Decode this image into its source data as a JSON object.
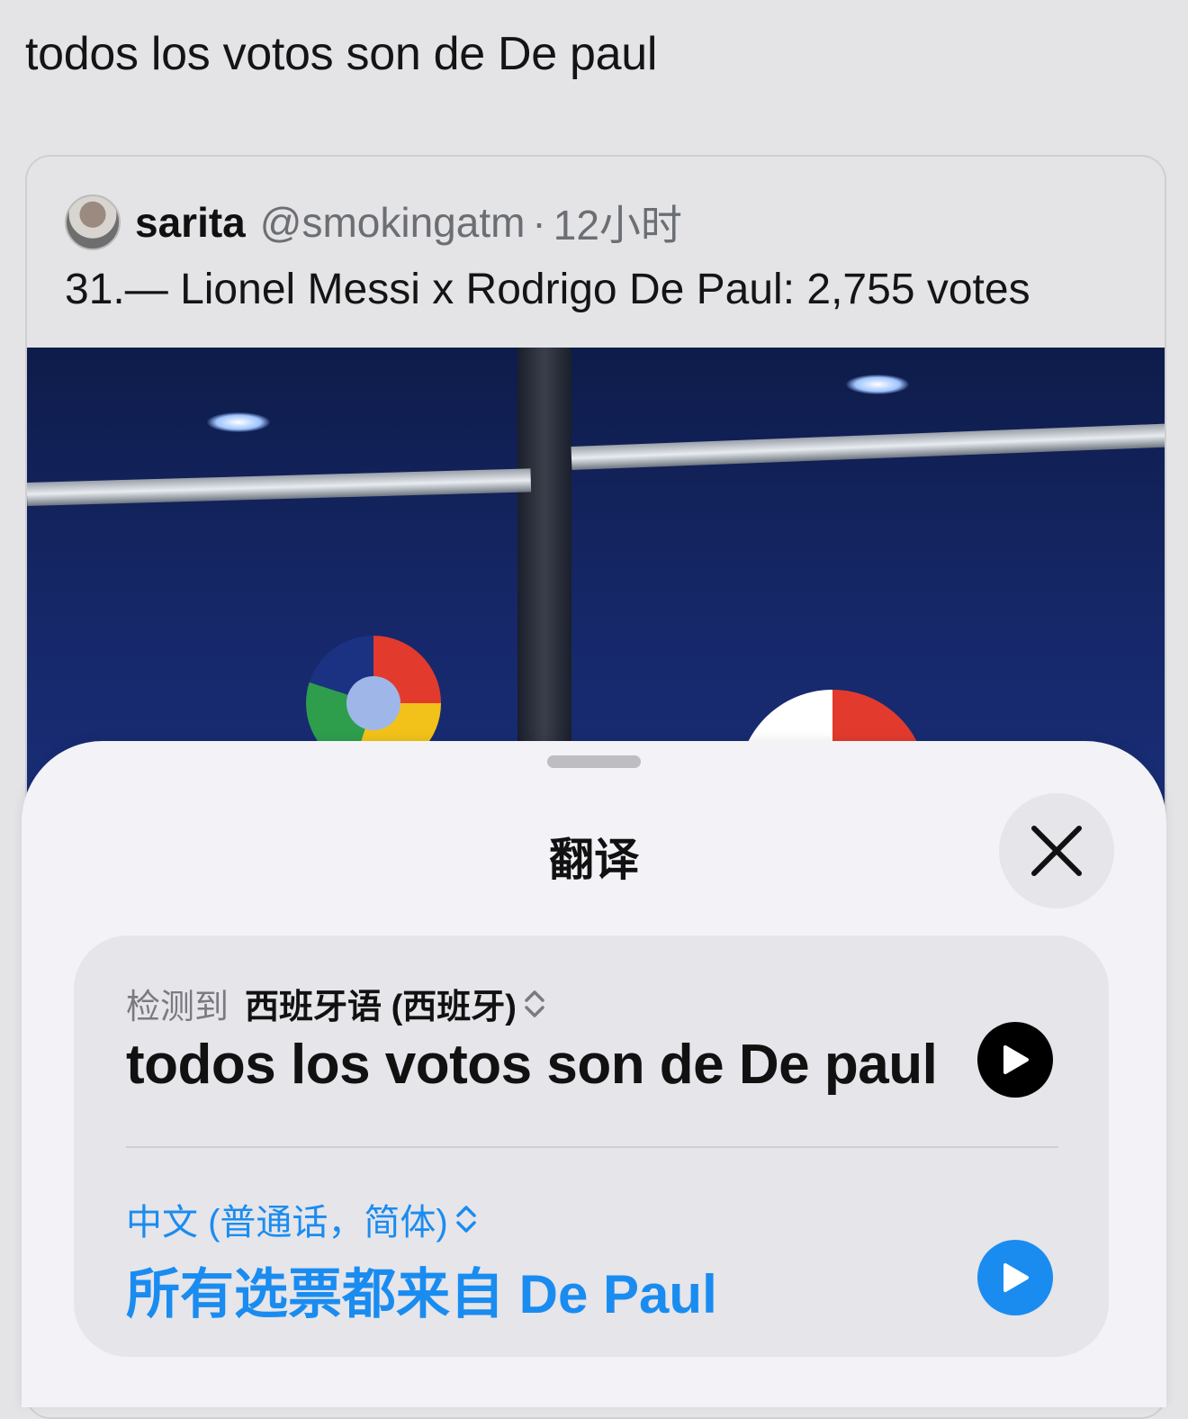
{
  "post": {
    "text": "todos los votos son de De paul"
  },
  "quote": {
    "name": "sarita",
    "handle": "@smokingatm",
    "separator": "·",
    "time": "12小时",
    "text": "31.— Lionel Messi x Rodrigo De Paul: 2,755 votes"
  },
  "sheet": {
    "title": "翻译",
    "source": {
      "detected_label": "检测到",
      "language": "西班牙语 (西班牙)",
      "text": "todos los votos son de De paul"
    },
    "target": {
      "language": "中文 (普通话，简体)",
      "text": "所有选票都来自 De Paul"
    }
  },
  "icons": {
    "close": "close-icon",
    "play": "play-icon",
    "chevron": "chevron-up-down-icon"
  },
  "colors": {
    "accent": "#1a8cf0",
    "sheet_bg": "#f2f2f7",
    "panel_bg": "#e5e5ea"
  }
}
